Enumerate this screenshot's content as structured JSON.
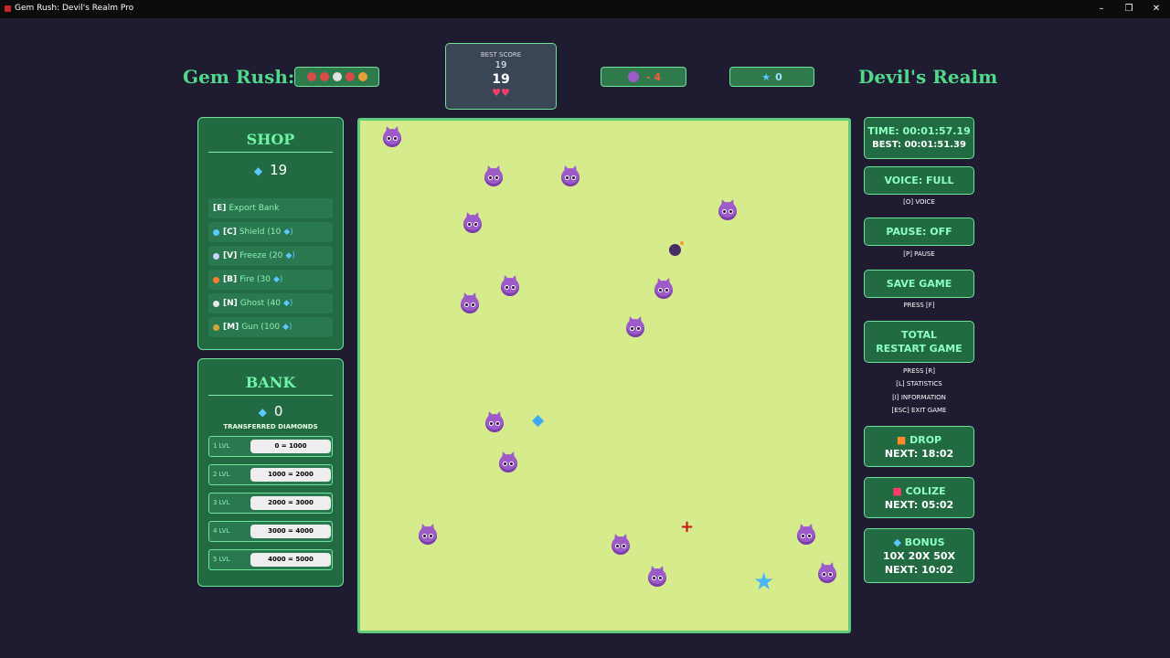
{
  "window": {
    "title": "Gem Rush: Devil's Realm Pro",
    "minimize_icon": "minimize-icon",
    "restore_icon": "restore-icon",
    "close_icon": "close-icon"
  },
  "header": {
    "title_left": "Gem Rush:",
    "title_right": "Devil's Realm",
    "faces": [
      "#d94a4a",
      "#d94a4a",
      "#e0e0e0",
      "#d94a4a",
      "#e2a23a"
    ],
    "best_score_label": "BEST SCORE",
    "best_score_small": "19",
    "best_score_big": "19",
    "hearts": "♥♥",
    "devils_value": "- 4",
    "stars_value": "0",
    "star_glyph": "★"
  },
  "shop": {
    "title": "SHOP",
    "gems": "19",
    "items": [
      {
        "key": "[E]",
        "label": "Export Bank",
        "icon_color": ""
      },
      {
        "key": "[C]",
        "label": "Shield (10",
        "icon_color": "#5bc8ff"
      },
      {
        "key": "[V]",
        "label": "Freeze (20",
        "icon_color": "#c7d2ff"
      },
      {
        "key": "[B]",
        "label": "Fire (30",
        "icon_color": "#ff7a2f"
      },
      {
        "key": "[N]",
        "label": "Ghost (40",
        "icon_color": "#e8e8e8"
      },
      {
        "key": "[M]",
        "label": "Gun (100",
        "icon_color": "#d4a43a"
      }
    ],
    "diamond_suffix": "💎)"
  },
  "bank": {
    "title": "BANK",
    "gems": "0",
    "subtitle": "TRANSFERRED DIAMONDS",
    "levels": [
      {
        "label": "1 LVL",
        "range": "0 = 1000"
      },
      {
        "label": "2 LVL",
        "range": "1000 = 2000"
      },
      {
        "label": "3 LVL",
        "range": "2000 = 3000"
      },
      {
        "label": "4 LVL",
        "range": "3000 = 4000"
      },
      {
        "label": "5 LVL",
        "range": "4000 = 5000"
      }
    ]
  },
  "board": {
    "crosshair": "+",
    "star": "★",
    "diamond": "◆"
  },
  "right": {
    "time": "TIME: 00:01:57.19",
    "best": "BEST: 00:01:51.39",
    "voice": "VOICE: FULL",
    "voice_hint": "[O] VOICE",
    "pause": "PAUSE: OFF",
    "pause_hint": "[P] PAUSE",
    "save": "SAVE GAME",
    "save_hint": "PRESS [F]",
    "restart": "TOTAL RESTART GAME",
    "restart_hint": "PRESS [R]",
    "stats_hint": "[L] STATISTICS",
    "info_hint": "[I] INFORMATION",
    "exit_hint": "[ESC] EXIT GAME",
    "drop": "DROP",
    "drop_next": "NEXT: 18:02",
    "colize": "COLIZE",
    "colize_next": "NEXT: 05:02",
    "bonus": "BONUS",
    "bonus_mult": "10X 20X 50X",
    "bonus_next": "NEXT: 10:02"
  }
}
